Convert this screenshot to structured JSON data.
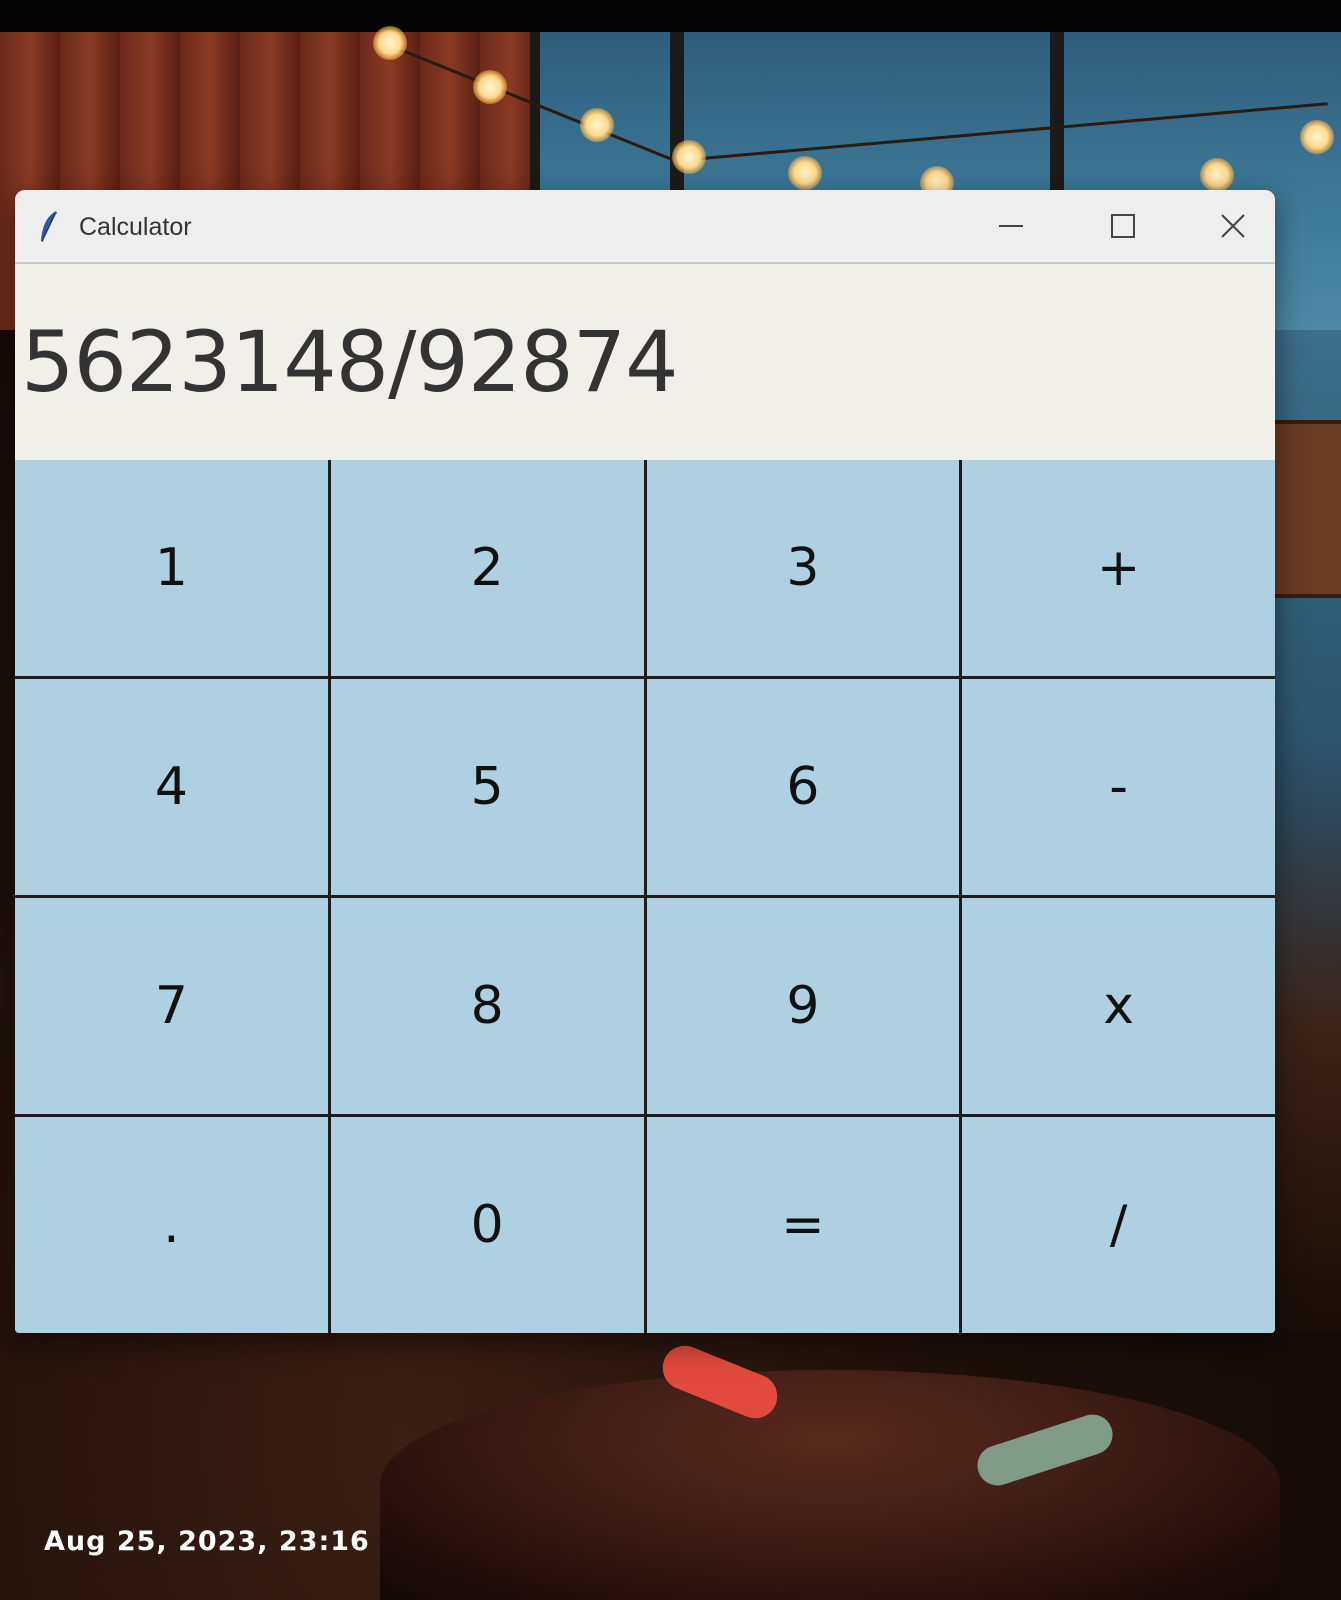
{
  "window": {
    "title": "Calculator",
    "icon": "feather-icon",
    "controls": [
      "minimize-icon",
      "maximize-icon",
      "close-icon"
    ]
  },
  "display": {
    "value": "5623148/92874"
  },
  "keypad": {
    "keys": [
      {
        "label": "1",
        "name": "key-1"
      },
      {
        "label": "2",
        "name": "key-2"
      },
      {
        "label": "3",
        "name": "key-3"
      },
      {
        "label": "+",
        "name": "key-plus"
      },
      {
        "label": "4",
        "name": "key-4"
      },
      {
        "label": "5",
        "name": "key-5"
      },
      {
        "label": "6",
        "name": "key-6"
      },
      {
        "label": "-",
        "name": "key-minus"
      },
      {
        "label": "7",
        "name": "key-7"
      },
      {
        "label": "8",
        "name": "key-8"
      },
      {
        "label": "9",
        "name": "key-9"
      },
      {
        "label": "x",
        "name": "key-multiply"
      },
      {
        "label": ".",
        "name": "key-decimal"
      },
      {
        "label": "0",
        "name": "key-0"
      },
      {
        "label": "=",
        "name": "key-equals"
      },
      {
        "label": "/",
        "name": "key-divide"
      }
    ]
  },
  "photo": {
    "timestamp": "Aug 25, 2023, 23:16"
  },
  "colors": {
    "key_background": "#aed0e0",
    "display_background": "#f1efea",
    "titlebar_background": "#eeeeee",
    "icon_accent": "#2c5aa0"
  }
}
